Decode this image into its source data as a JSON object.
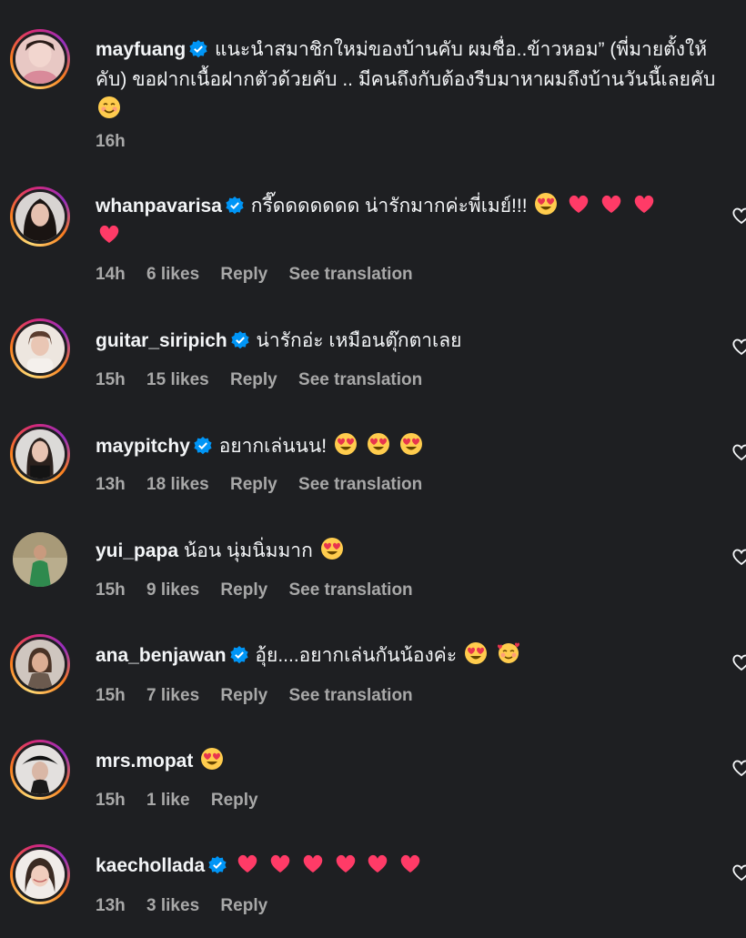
{
  "colors": {
    "background": "#1e1f22",
    "meta_text": "#a8a8a8",
    "verified": "#0095f6",
    "heart_emoji": "#ff3b67"
  },
  "labels": {
    "reply": "Reply",
    "see_translation": "See translation"
  },
  "comments": [
    {
      "username": "mayfuang",
      "verified": true,
      "text": "แนะนำสมาชิกใหม่ของบ้านคับ ผมชื่อ..ข้าวหอม” (พี่มายตั้งให้คับ) ขอฝากเนื้อฝากตัวด้วยคับ .. มีคนถึงกับต้องรีบมาหาผมถึงบ้านวันนี้เลยคับ",
      "emojis": [
        "smiling-face-icon"
      ],
      "time": "16h",
      "likes": "",
      "has_reply": false,
      "has_translation": false
    },
    {
      "username": "whanpavarisa",
      "verified": true,
      "text": "กรี๊ดดดดดดด น่ารักมากค่ะพี่เมย์!!!",
      "emojis": [
        "heart-eyes-icon",
        "heart-icon",
        "heart-icon",
        "heart-icon",
        "heart-icon"
      ],
      "time": "14h",
      "likes": "6 likes",
      "has_reply": true,
      "has_translation": true
    },
    {
      "username": "guitar_siripich",
      "verified": true,
      "text": "น่ารักอ่ะ เหมือนตุ๊กตาเลย",
      "emojis": [],
      "time": "15h",
      "likes": "15 likes",
      "has_reply": true,
      "has_translation": true
    },
    {
      "username": "maypitchy",
      "verified": true,
      "text": "อยากเล่นนน!",
      "emojis": [
        "heart-eyes-icon",
        "heart-eyes-icon",
        "heart-eyes-icon"
      ],
      "time": "13h",
      "likes": "18 likes",
      "has_reply": true,
      "has_translation": true
    },
    {
      "username": "yui_papa",
      "verified": false,
      "text": "น้อน นุ่มนิ่มมาก",
      "emojis": [
        "heart-eyes-icon"
      ],
      "time": "15h",
      "likes": "9 likes",
      "has_reply": true,
      "has_translation": true
    },
    {
      "username": "ana_benjawan",
      "verified": true,
      "text": "อุ้ย....อยากเล่นกันน้องค่ะ",
      "emojis": [
        "heart-eyes-icon",
        "smiling-hearts-icon"
      ],
      "time": "15h",
      "likes": "7 likes",
      "has_reply": true,
      "has_translation": true
    },
    {
      "username": "mrs.mopat",
      "verified": false,
      "text": "",
      "emojis": [
        "heart-eyes-icon"
      ],
      "time": "15h",
      "likes": "1 like",
      "has_reply": true,
      "has_translation": false
    },
    {
      "username": "kaechollada",
      "verified": true,
      "text": "",
      "emojis": [
        "heart-icon",
        "heart-icon",
        "heart-icon",
        "heart-icon",
        "heart-icon",
        "heart-icon"
      ],
      "time": "13h",
      "likes": "3 likes",
      "has_reply": true,
      "has_translation": false
    }
  ]
}
